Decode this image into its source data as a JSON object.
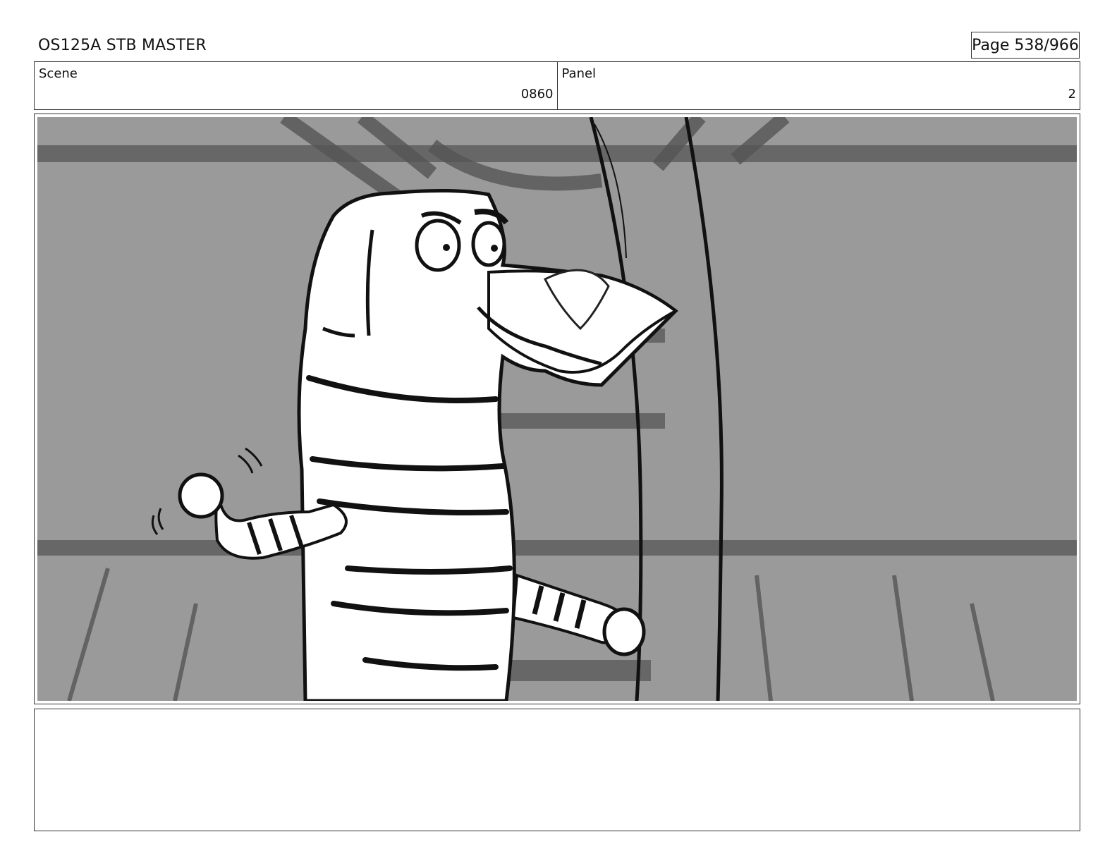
{
  "header": {
    "title": "OS125A STB MASTER",
    "page": "Page 538/966"
  },
  "info": {
    "scene_label": "Scene",
    "scene_value": "0860",
    "panel_label": "Panel",
    "panel_value": "2"
  },
  "notes": {
    "text": ""
  },
  "colors": {
    "background_gray": "#9a9a9a",
    "line_dark": "#1a1a1a",
    "beam_shadow": "#5a5a5a"
  }
}
